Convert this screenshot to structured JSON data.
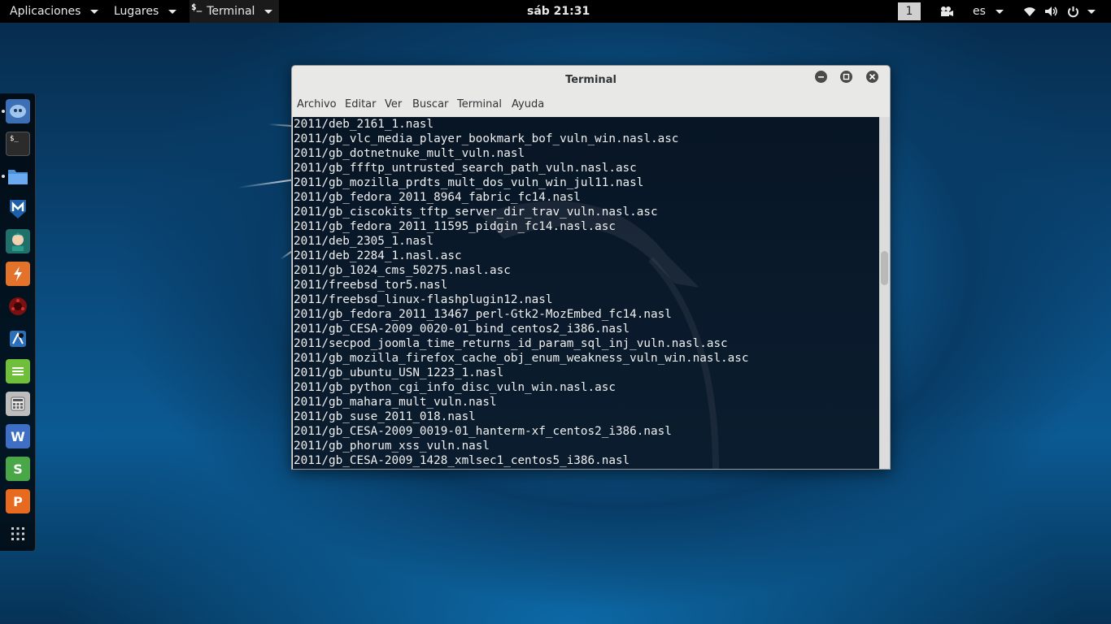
{
  "topbar": {
    "applications": "Aplicaciones",
    "places": "Lugares",
    "app_icon": "$_",
    "app_name": "Terminal",
    "clock": "sáb 21:31",
    "workspace": "1",
    "language": "es"
  },
  "dock": {
    "items": [
      {
        "icon": "pidgin-icon",
        "color": "#3d6fb4"
      },
      {
        "icon": "terminal-icon",
        "color": "#2b2b2b"
      },
      {
        "icon": "files-icon",
        "color": "#4a90d9"
      },
      {
        "icon": "metasploit-icon",
        "color": "#1d5fa8"
      },
      {
        "icon": "armitage-icon",
        "color": "#2a9c8a"
      },
      {
        "icon": "burpsuite-icon",
        "color": "#e3722b"
      },
      {
        "icon": "maltego-icon",
        "color": "#7a1010"
      },
      {
        "icon": "beef-icon",
        "color": "#2a6fb8"
      },
      {
        "icon": "text-editor-icon",
        "color": "#6fbf3b"
      },
      {
        "icon": "calculator-icon",
        "color": "#bdbdbd"
      },
      {
        "icon": "writer-icon",
        "color": "#3e6fc5"
      },
      {
        "icon": "spreadsheet-icon",
        "color": "#4aa748"
      },
      {
        "icon": "presentation-icon",
        "color": "#e86a1f"
      },
      {
        "icon": "show-apps-icon",
        "color": "#000000"
      }
    ]
  },
  "window": {
    "title": "Terminal",
    "menu": [
      "Archivo",
      "Editar",
      "Ver",
      "Buscar",
      "Terminal",
      "Ayuda"
    ],
    "lines": [
      "2011/deb_2161_1.nasl",
      "2011/gb_vlc_media_player_bookmark_bof_vuln_win.nasl.asc",
      "2011/gb_dotnetnuke_mult_vuln.nasl",
      "2011/gb_ffftp_untrusted_search_path_vuln.nasl.asc",
      "2011/gb_mozilla_prdts_mult_dos_vuln_win_jul11.nasl",
      "2011/gb_fedora_2011_8964_fabric_fc14.nasl",
      "2011/gb_ciscokits_tftp_server_dir_trav_vuln.nasl.asc",
      "2011/gb_fedora_2011_11595_pidgin_fc14.nasl.asc",
      "2011/deb_2305_1.nasl",
      "2011/deb_2284_1.nasl.asc",
      "2011/gb_1024_cms_50275.nasl.asc",
      "2011/freebsd_tor5.nasl",
      "2011/freebsd_linux-flashplugin12.nasl",
      "2011/gb_fedora_2011_13467_perl-Gtk2-MozEmbed_fc14.nasl",
      "2011/gb_CESA-2009_0020-01_bind_centos2_i386.nasl",
      "2011/secpod_joomla_time_returns_id_param_sql_inj_vuln.nasl.asc",
      "2011/gb_mozilla_firefox_cache_obj_enum_weakness_vuln_win.nasl.asc",
      "2011/gb_ubuntu_USN_1223_1.nasl",
      "2011/gb_python_cgi_info_disc_vuln_win.nasl.asc",
      "2011/gb_mahara_mult_vuln.nasl",
      "2011/gb_suse_2011_018.nasl",
      "2011/gb_CESA-2009_0019-01_hanterm-xf_centos2_i386.nasl",
      "2011/gb_phorum_xss_vuln.nasl",
      "2011/gb_CESA-2009_1428_xmlsec1_centos5_i386.nasl"
    ],
    "scroll_fraction": 0.42
  }
}
